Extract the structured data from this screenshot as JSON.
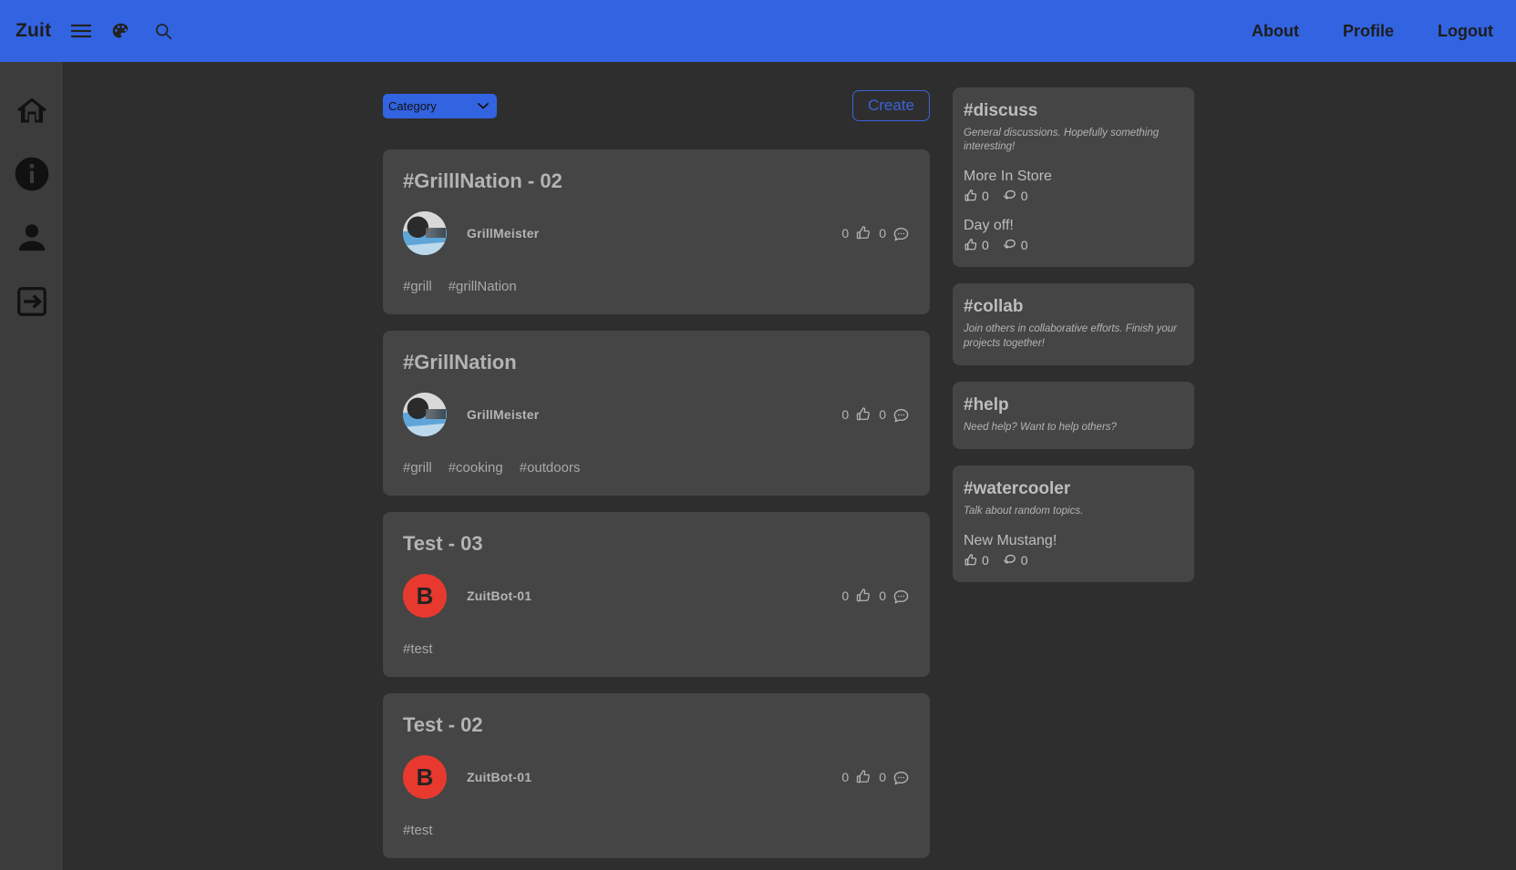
{
  "topbar": {
    "brand": "Zuit",
    "icons": [
      {
        "name": "hamburger-menu-icon"
      },
      {
        "name": "palette-icon"
      },
      {
        "name": "search-icon"
      }
    ],
    "links": [
      {
        "label": "About"
      },
      {
        "label": "Profile"
      },
      {
        "label": "Logout"
      }
    ],
    "background_color": "#3263e0"
  },
  "sidebar": {
    "items": [
      {
        "name": "home-icon",
        "label": "Home"
      },
      {
        "name": "info-icon",
        "label": "About"
      },
      {
        "name": "person-icon",
        "label": "Profile"
      },
      {
        "name": "logout-icon",
        "label": "Logout"
      }
    ],
    "background_color": "#3c3c3c"
  },
  "toolbar": {
    "category_selected": "Category",
    "category_options": [
      "Category"
    ],
    "create_label": "Create",
    "create_color": "#3b63d8"
  },
  "feed": {
    "posts": [
      {
        "title": "#GrilllNation - 02",
        "author": "GrillMeister",
        "avatar_type": "photo",
        "avatar_letter": "",
        "likes": "0",
        "comments": "0",
        "tags": [
          "#grill",
          "#grillNation"
        ]
      },
      {
        "title": "#GrillNation",
        "author": "GrillMeister",
        "avatar_type": "photo",
        "avatar_letter": "",
        "likes": "0",
        "comments": "0",
        "tags": [
          "#grill",
          "#cooking",
          "#outdoors"
        ]
      },
      {
        "title": "Test - 03",
        "author": "ZuitBot-01",
        "avatar_type": "letter",
        "avatar_letter": "B",
        "likes": "0",
        "comments": "0",
        "tags": [
          "#test"
        ]
      },
      {
        "title": "Test - 02",
        "author": "ZuitBot-01",
        "avatar_type": "letter",
        "avatar_letter": "B",
        "likes": "0",
        "comments": "0",
        "tags": [
          "#test"
        ]
      }
    ]
  },
  "rail": {
    "categories": [
      {
        "title": "#discuss",
        "description": "General discussions. Hopefully something interesting!",
        "posts": [
          {
            "title": "More In Store",
            "likes": "0",
            "comments": "0"
          },
          {
            "title": "Day off!",
            "likes": "0",
            "comments": "0"
          }
        ]
      },
      {
        "title": "#collab",
        "description": "Join others in collaborative efforts. Finish your projects together!",
        "posts": []
      },
      {
        "title": "#help",
        "description": "Need help? Want to help others?",
        "posts": []
      },
      {
        "title": "#watercooler",
        "description": "Talk about random topics.",
        "posts": [
          {
            "title": "New Mustang!",
            "likes": "0",
            "comments": "0"
          }
        ]
      }
    ]
  },
  "colors": {
    "page_background": "#2e2e2e",
    "card_background": "#454545",
    "accent_blue": "#3263e0",
    "avatar_red": "#e8392f"
  }
}
